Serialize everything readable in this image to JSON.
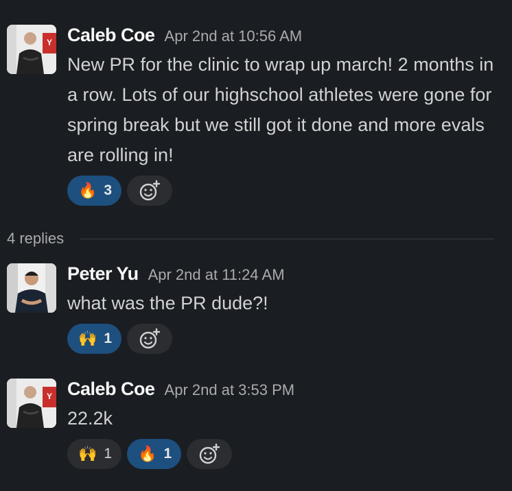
{
  "messages": [
    {
      "author": "Caleb Coe",
      "timestamp": "Apr 2nd at 10:56 AM",
      "text": "New PR for the clinic to wrap up march! 2 months in a row. Lots of our highschool athletes were gone for spring break but we still got it done and more evals are rolling in!",
      "avatar_icon": "caleb-avatar",
      "reactions": [
        {
          "emoji": "🔥",
          "name": "fire",
          "count": "3",
          "active": true
        }
      ]
    },
    {
      "author": "Peter Yu",
      "timestamp": "Apr 2nd at 11:24 AM",
      "text": "what was the PR dude?!",
      "avatar_icon": "peter-avatar",
      "reactions": [
        {
          "emoji": "🙌",
          "name": "raised-hands",
          "count": "1",
          "active": true
        }
      ]
    },
    {
      "author": "Caleb Coe",
      "timestamp": "Apr 2nd at 3:53 PM",
      "text": "22.2k",
      "avatar_icon": "caleb-avatar",
      "reactions": [
        {
          "emoji": "🙌",
          "name": "raised-hands",
          "count": "1",
          "active": false
        },
        {
          "emoji": "🔥",
          "name": "fire",
          "count": "1",
          "active": true
        }
      ]
    }
  ],
  "thread": {
    "replies_label": "4 replies"
  },
  "colors": {
    "background": "#1a1d21",
    "active_reaction": "#1d4f7f",
    "inactive_reaction": "#2c2d31"
  }
}
